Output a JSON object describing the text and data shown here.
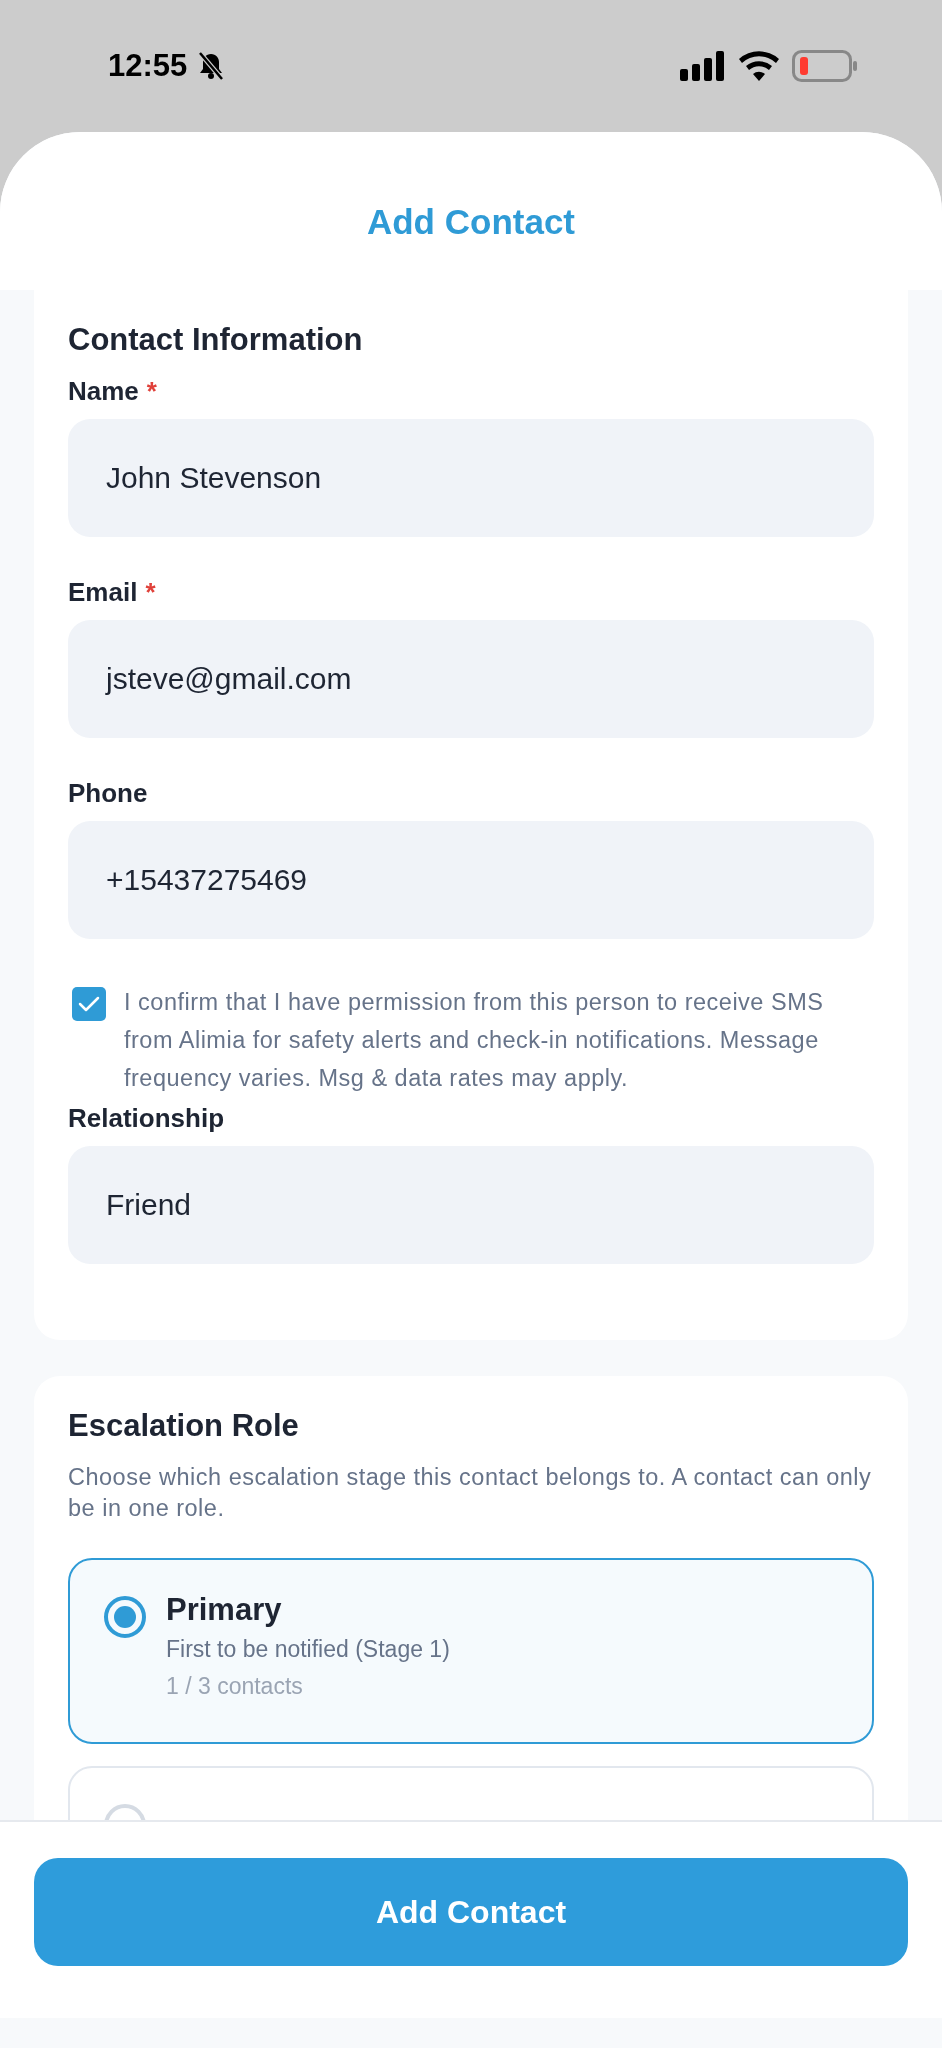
{
  "status_bar": {
    "time": "12:55"
  },
  "header": {
    "title": "Add Contact"
  },
  "contact_information": {
    "title": "Contact Information",
    "fields": [
      {
        "label": "Name",
        "required_mark": "*",
        "value": "John Stevenson"
      },
      {
        "label": "Email",
        "required_mark": "*",
        "value": "jsteve@gmail.com"
      },
      {
        "label": "Phone",
        "value": "+15437275469"
      }
    ],
    "consent": {
      "checked": true,
      "text": "I confirm that I have permission from this person to receive SMS from Alimia for safety alerts and check-in notifications. Message frequency varies. Msg & data rates may apply."
    },
    "relationship": {
      "label": "Relationship",
      "value": "Friend"
    }
  },
  "escalation_role": {
    "title": "Escalation Role",
    "description": "Choose which escalation stage this contact belongs to. A contact can only be in one role.",
    "options": [
      {
        "label": "Primary",
        "description": "First to be notified (Stage 1)",
        "count": "1 / 3 contacts",
        "selected": true
      },
      {
        "selected": false
      }
    ]
  },
  "footer": {
    "button": "Add Contact"
  }
}
